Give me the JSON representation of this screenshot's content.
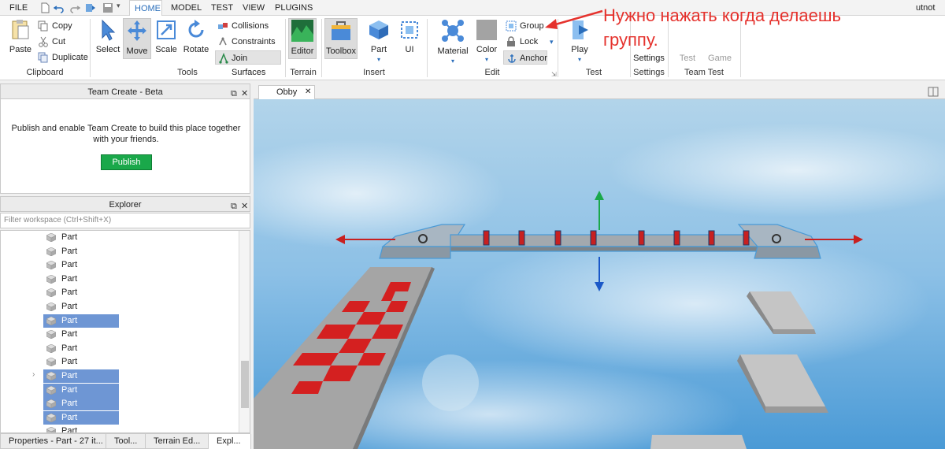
{
  "menu": {
    "file": "FILE",
    "tabs": [
      "HOME",
      "MODEL",
      "TEST",
      "VIEW",
      "PLUGINS"
    ],
    "user": "utnot"
  },
  "ribbon": {
    "clipboard": {
      "paste": "Paste",
      "copy": "Copy",
      "cut": "Cut",
      "duplicate": "Duplicate",
      "label": "Clipboard"
    },
    "tools": {
      "select": "Select",
      "move": "Move",
      "scale": "Scale",
      "rotate": "Rotate",
      "collisions": "Collisions",
      "constraints": "Constraints",
      "join_surfaces": "Join Surfaces",
      "label": "Tools"
    },
    "terrain": {
      "editor": "Editor",
      "label": "Terrain"
    },
    "insert": {
      "toolbox": "Toolbox",
      "part": "Part",
      "ui": "UI",
      "label": "Insert"
    },
    "edit": {
      "material": "Material",
      "color": "Color",
      "group": "Group",
      "lock": "Lock",
      "anchor": "Anchor",
      "label": "Edit"
    },
    "test": {
      "play": "Play",
      "label": "Test"
    },
    "settings": {
      "top": "Settings",
      "bottom": "Settings"
    },
    "team_test": {
      "test": "Test",
      "game": "Game",
      "label": "Team Test"
    }
  },
  "annotation": {
    "line1": "Нужно нажать когда делаешь",
    "line2": "группу."
  },
  "team_create": {
    "title": "Team Create - Beta",
    "message": "Publish and enable Team Create to build this place together with your friends.",
    "publish": "Publish"
  },
  "explorer": {
    "title": "Explorer",
    "filter_placeholder": "Filter workspace (Ctrl+Shift+X)",
    "rows": [
      {
        "label": "Part",
        "selected": false
      },
      {
        "label": "Part",
        "selected": false
      },
      {
        "label": "Part",
        "selected": false
      },
      {
        "label": "Part",
        "selected": false
      },
      {
        "label": "Part",
        "selected": false
      },
      {
        "label": "Part",
        "selected": false
      },
      {
        "label": "Part",
        "selected": true
      },
      {
        "label": "Part",
        "selected": false
      },
      {
        "label": "Part",
        "selected": false
      },
      {
        "label": "Part",
        "selected": false
      },
      {
        "label": "Part",
        "selected": true
      },
      {
        "label": "Part",
        "selected": true
      },
      {
        "label": "Part",
        "selected": true
      },
      {
        "label": "Part",
        "selected": true
      },
      {
        "label": "Part",
        "selected": false
      }
    ]
  },
  "bottom_tabs": [
    "Properties - Part - 27 it...",
    "Tool...",
    "Terrain Ed...",
    "Expl..."
  ],
  "document": {
    "tab": "Obby"
  },
  "colors": {
    "accent": "#2a6ebb",
    "selection": "#6e96d4",
    "publish": "#1aa84a",
    "annotation": "#e5322d",
    "checker_red": "#d42020"
  }
}
